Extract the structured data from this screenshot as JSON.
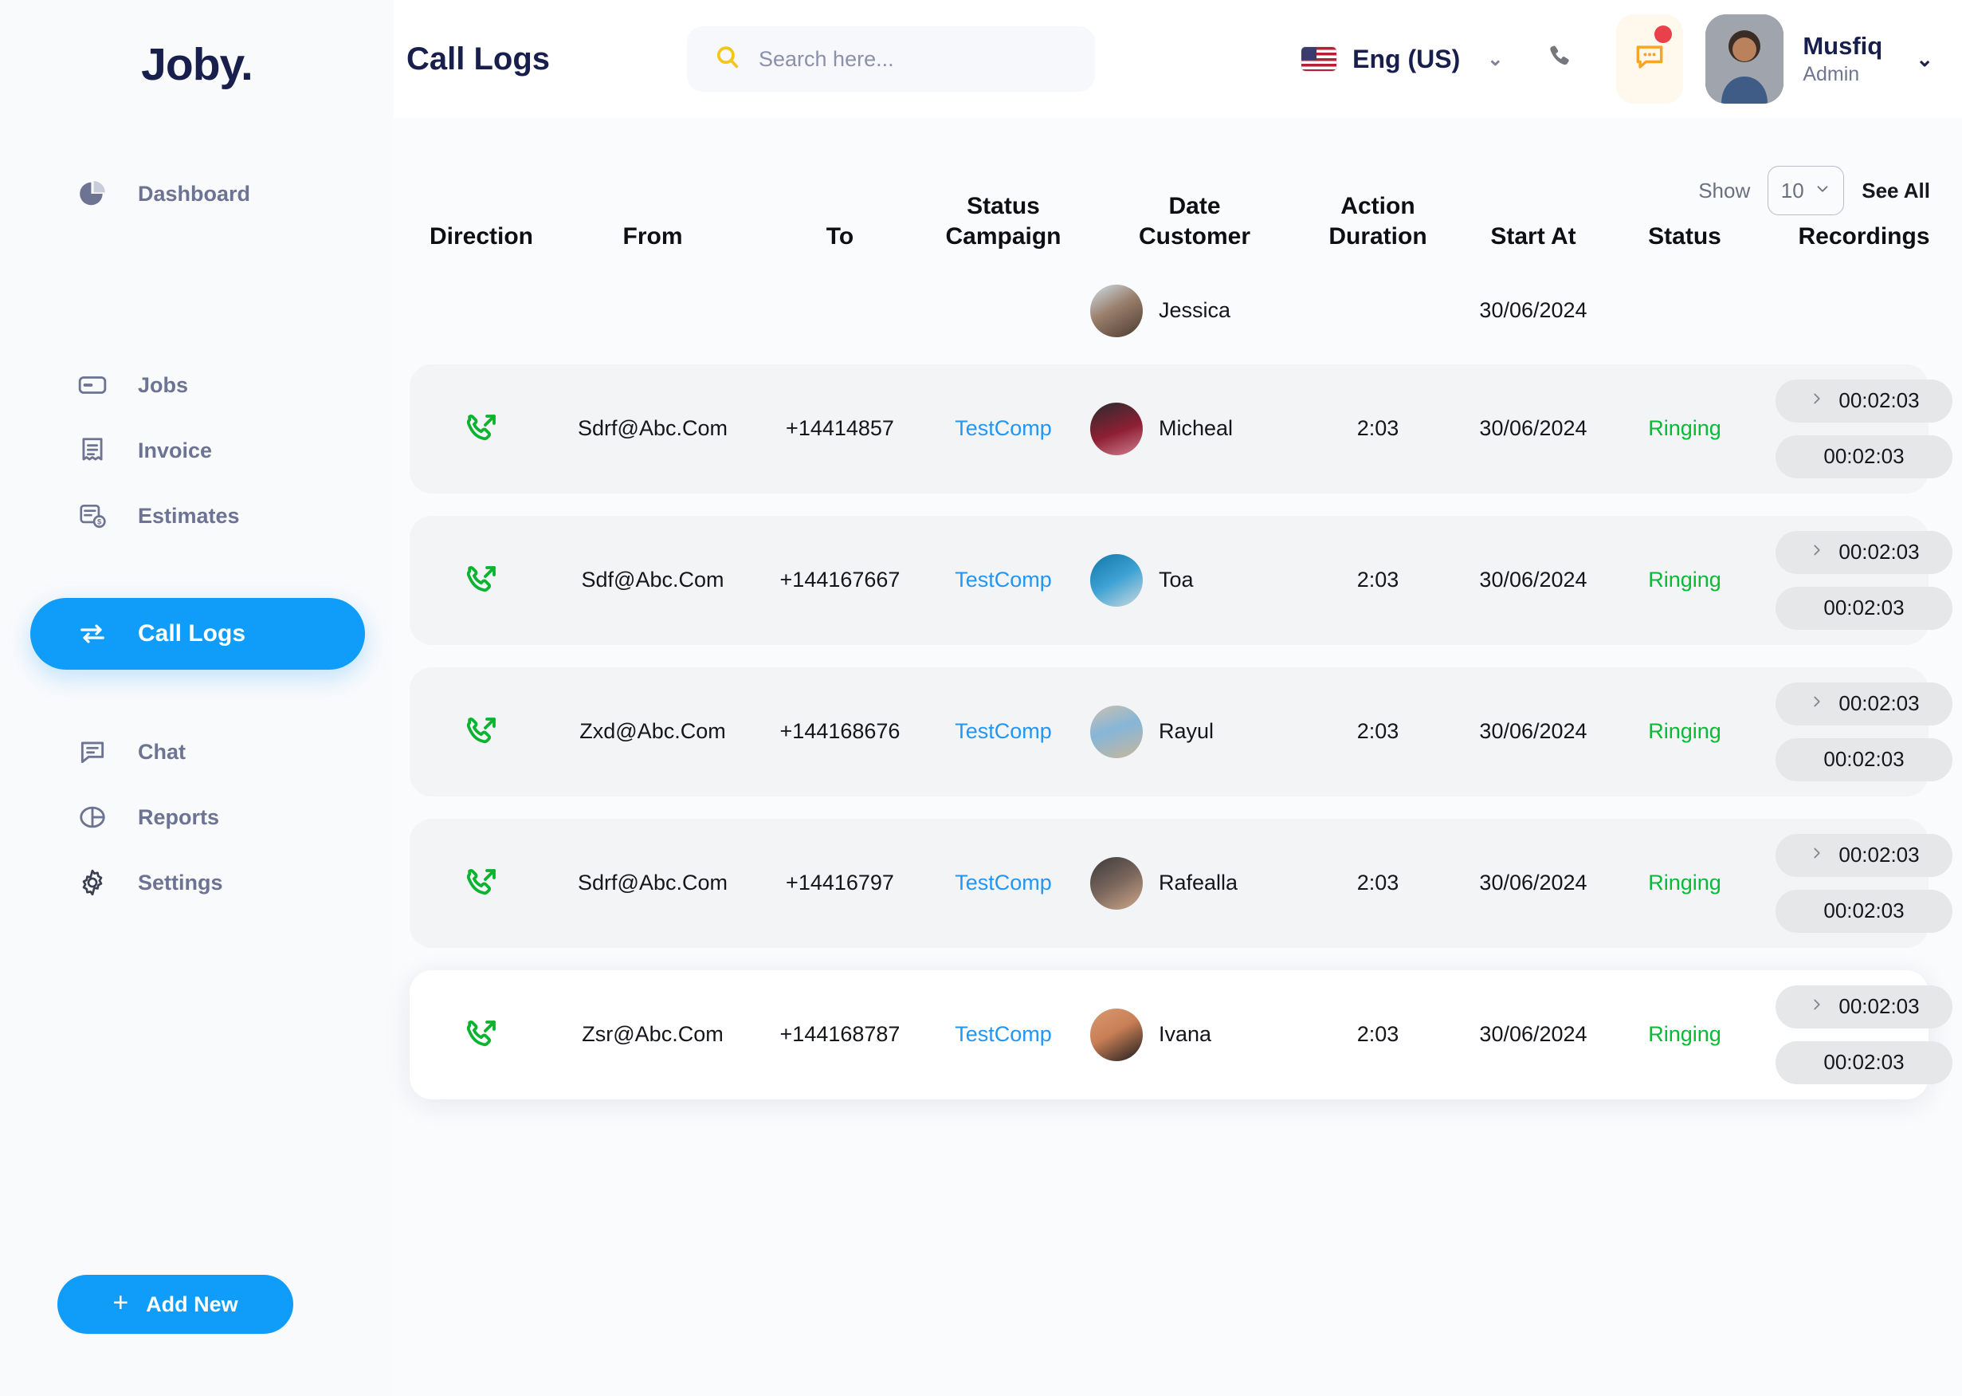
{
  "app": {
    "brand": "Joby."
  },
  "sidebar": {
    "items": [
      {
        "label": "Dashboard",
        "icon": "pie-chart-icon",
        "active": false
      },
      {
        "label": "Jobs",
        "icon": "card-icon",
        "active": false
      },
      {
        "label": "Invoice",
        "icon": "receipt-icon",
        "active": false
      },
      {
        "label": "Estimates",
        "icon": "estimate-dollar-icon",
        "active": false
      },
      {
        "label": "Call Logs",
        "icon": "transfer-arrows-icon",
        "active": true
      },
      {
        "label": "Chat",
        "icon": "chat-bubble-icon",
        "active": false
      },
      {
        "label": "Reports",
        "icon": "pie-split-icon",
        "active": false
      },
      {
        "label": "Settings",
        "icon": "gear-icon",
        "active": false
      }
    ],
    "add_new_label": "Add New",
    "add_new_icon": "plus-icon"
  },
  "header": {
    "title": "Call Logs",
    "search": {
      "placeholder": "Search here...",
      "value": "",
      "icon": "search-icon"
    },
    "language": {
      "label": "Eng (US)",
      "flag": "us-flag-icon",
      "caret": "chevron-down-icon"
    },
    "phone_icon": "phone-icon",
    "chat_icon": "chat-notification-icon",
    "chat_has_unread": true,
    "user": {
      "name": "Musfiq",
      "role": "Admin",
      "avatar": "user-avatar",
      "caret": "chevron-down-icon"
    }
  },
  "controls": {
    "show_label": "Show",
    "page_size": "10",
    "page_size_caret": "chevron-down-icon",
    "see_all_label": "See All"
  },
  "table": {
    "columns": [
      {
        "top": "",
        "main": "Direction"
      },
      {
        "top": "",
        "main": "From"
      },
      {
        "top": "",
        "main": "To"
      },
      {
        "top": "Status",
        "main": "Campaign"
      },
      {
        "top": "Date",
        "main": "Customer"
      },
      {
        "top": "Action",
        "main": "Duration"
      },
      {
        "top": "",
        "main": "Start At"
      },
      {
        "top": "",
        "main": "Status"
      },
      {
        "top": "",
        "main": "Recordings"
      }
    ],
    "preview_row": {
      "customer": "Jessica",
      "date": "30/06/2024"
    },
    "rows": [
      {
        "direction": "outgoing-call-icon",
        "from": "Sdrf@Abc.Com",
        "to": "+14414857",
        "campaign": "TestComp",
        "customer": "Micheal",
        "duration": "2:03",
        "start_at": "30/06/2024",
        "status": "Ringing",
        "recordings": [
          "00:02:03",
          "00:02:03"
        ]
      },
      {
        "direction": "outgoing-call-icon",
        "from": "Sdf@Abc.Com",
        "to": "+144167667",
        "campaign": "TestComp",
        "customer": "Toa",
        "duration": "2:03",
        "start_at": "30/06/2024",
        "status": "Ringing",
        "recordings": [
          "00:02:03",
          "00:02:03"
        ]
      },
      {
        "direction": "outgoing-call-icon",
        "from": "Zxd@Abc.Com",
        "to": "+144168676",
        "campaign": "TestComp",
        "customer": "Rayul",
        "duration": "2:03",
        "start_at": "30/06/2024",
        "status": "Ringing",
        "recordings": [
          "00:02:03",
          "00:02:03"
        ]
      },
      {
        "direction": "outgoing-call-icon",
        "from": "Sdrf@Abc.Com",
        "to": "+14416797",
        "campaign": "TestComp",
        "customer": "Rafealla",
        "duration": "2:03",
        "start_at": "30/06/2024",
        "status": "Ringing",
        "recordings": [
          "00:02:03",
          "00:02:03"
        ]
      },
      {
        "direction": "outgoing-call-icon",
        "from": "Zsr@Abc.Com",
        "to": "+144168787",
        "campaign": "TestComp",
        "customer": "Ivana",
        "duration": "2:03",
        "start_at": "30/06/2024",
        "status": "Ringing",
        "recordings": [
          "00:02:03",
          "00:02:03"
        ]
      }
    ]
  },
  "colors": {
    "accent": "#109cf9",
    "brand_navy": "#191f4d",
    "link": "#2196f3",
    "success": "#0ab936",
    "search_icon": "#f5c518",
    "chat_icon": "#f5a623",
    "unread_dot": "#e8414a"
  }
}
